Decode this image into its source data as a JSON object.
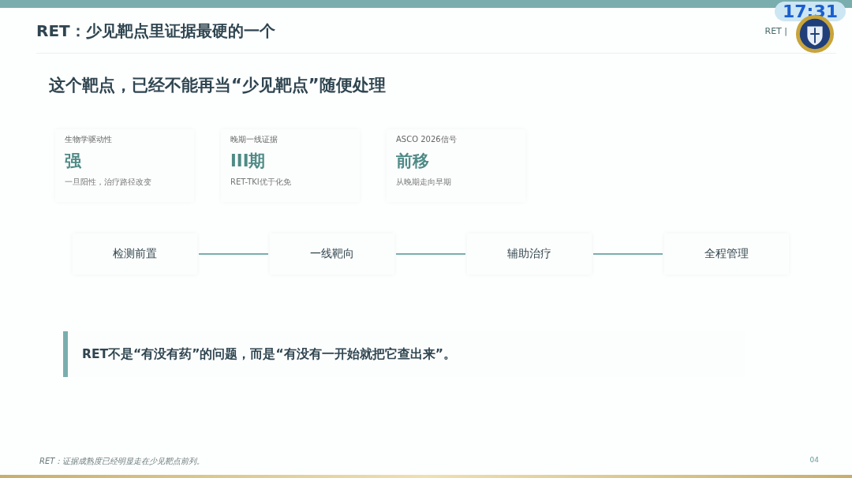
{
  "overlay": {
    "clock": "17:31"
  },
  "header": {
    "title": "RET：少见靶点里证据最硬的一个",
    "tag": "RET |"
  },
  "headline": "这个靶点，已经不能再当“少见靶点”随便处理",
  "cards": [
    {
      "label": "生物学驱动性",
      "value": "强",
      "note": "一旦阳性，治疗路径改变"
    },
    {
      "label": "晚期一线证据",
      "value": "III期",
      "note": "RET-TKI优于化免"
    },
    {
      "label": "ASCO 2026信号",
      "value": "前移",
      "note": "从晚期走向早期"
    }
  ],
  "steps": [
    "检测前置",
    "一线靶向",
    "辅助治疗",
    "全程管理"
  ],
  "callout": "RET不是“有没有药”的问题，而是“有没有一开始就把它查出来”。",
  "footer": {
    "note": "RET：证据成熟度已经明显走在少见靶点前列。",
    "page": "04"
  }
}
